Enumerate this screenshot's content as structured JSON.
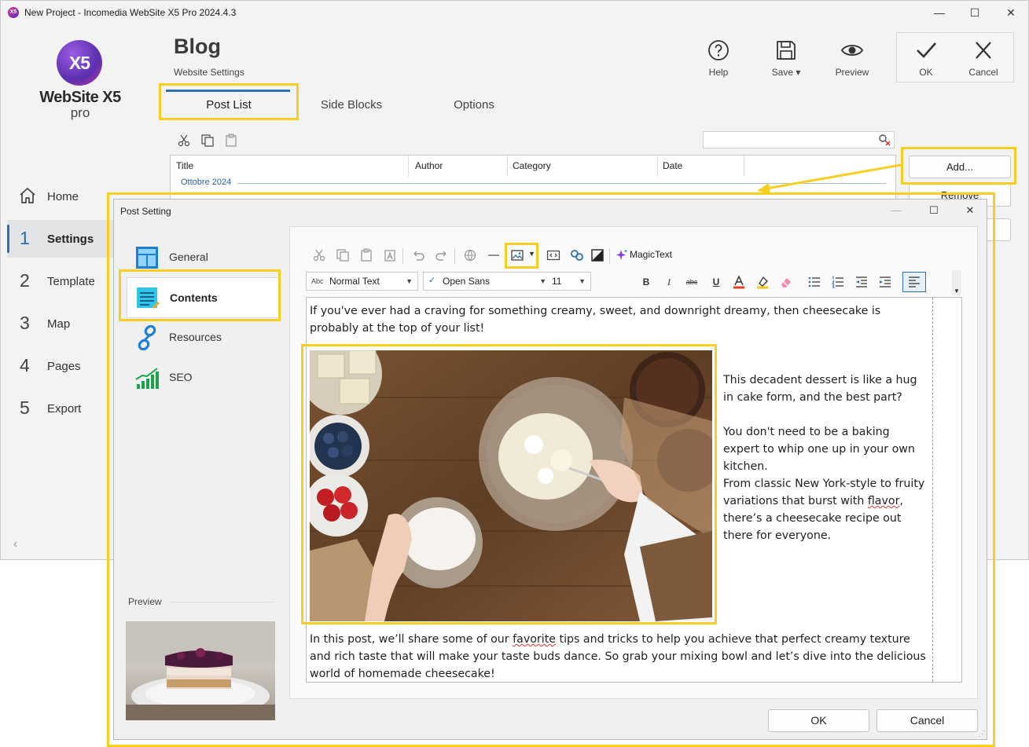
{
  "window": {
    "title": "New Project - Incomedia WebSite X5 Pro 2024.4.3",
    "app_icon_text": "X5",
    "minimize": "—",
    "maximize": "☐",
    "close": "✕"
  },
  "logo": {
    "mark": "X5",
    "brand": "WebSite X5",
    "edition": "pro"
  },
  "nav": {
    "home": "Home",
    "items": [
      {
        "num": "1",
        "label": "Settings"
      },
      {
        "num": "2",
        "label": "Template"
      },
      {
        "num": "3",
        "label": "Map"
      },
      {
        "num": "4",
        "label": "Pages"
      },
      {
        "num": "5",
        "label": "Export"
      }
    ],
    "collapse": "‹"
  },
  "header": {
    "title": "Blog",
    "subtitle": "Website Settings",
    "help": "Help",
    "save": "Save ▾",
    "preview": "Preview",
    "ok": "OK",
    "cancel": "Cancel"
  },
  "tabs": [
    "Post List",
    "Side Blocks",
    "Options"
  ],
  "table": {
    "columns": [
      "Title",
      "Author",
      "Category",
      "Date"
    ],
    "group": "Ottobre 2024"
  },
  "side_buttons": {
    "add": "Add...",
    "remove": "Remove"
  },
  "dialog": {
    "title": "Post Setting",
    "nav": [
      "General",
      "Contents",
      "Resources",
      "SEO"
    ],
    "preview_label": "Preview",
    "ok": "OK",
    "cancel": "Cancel"
  },
  "editor": {
    "magictext": "MagicText",
    "style_combo": "Normal Text",
    "style_prefix": "Abc",
    "font_combo": "Open Sans",
    "size_combo": "11",
    "paragraphs": {
      "p1": "If you've ever had a craving for something creamy, sweet, and downright dreamy, then cheesecake is probably at the top of your list!",
      "side1": "This decadent dessert is like a hug in cake form, and the best part?",
      "side2": "You don't need to be a baking expert to whip one up in your own kitchen.",
      "side3a": "From classic New York-style to fruity variations that burst with ",
      "side3b": "flavor",
      "side3c": ", there’s a cheesecake recipe out there for everyone.",
      "p_end_a": "In this post, we’ll share some of our ",
      "p_end_b": "favorite",
      "p_end_c": " tips and tricks to help you achieve that perfect creamy texture and rich taste that will make your taste buds dance. So grab your mixing bowl and let’s dive into the delicious world of homemade cheesecake!"
    }
  },
  "colors": {
    "accent": "#2c6fb3",
    "highlight": "#f5cf22"
  }
}
